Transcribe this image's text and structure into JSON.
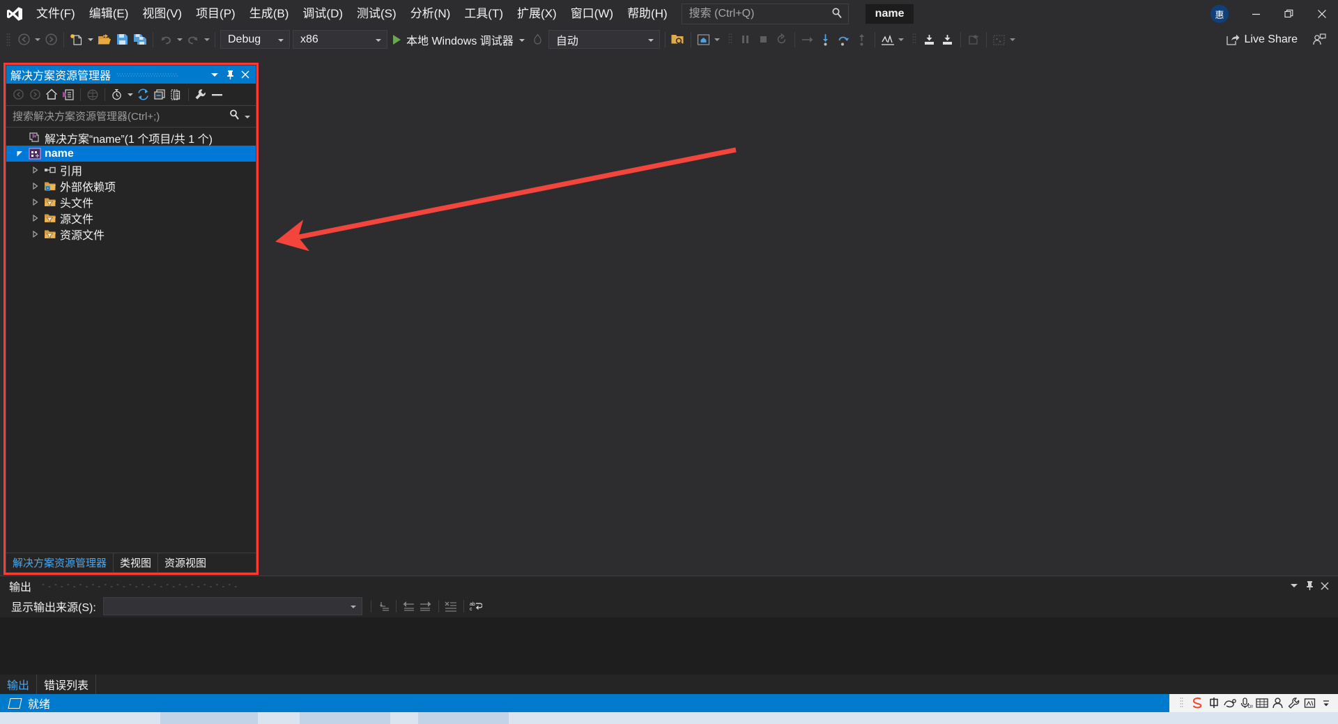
{
  "window": {
    "project_chip": "name",
    "avatar_initial": "惠",
    "live_share": "Live Share",
    "minimize": "—",
    "restore": "❐",
    "close": "✕"
  },
  "menubar": {
    "items": [
      {
        "label": "文件(F)",
        "name": "menu-file"
      },
      {
        "label": "编辑(E)",
        "name": "menu-edit"
      },
      {
        "label": "视图(V)",
        "name": "menu-view"
      },
      {
        "label": "项目(P)",
        "name": "menu-project"
      },
      {
        "label": "生成(B)",
        "name": "menu-build"
      },
      {
        "label": "调试(D)",
        "name": "menu-debug"
      },
      {
        "label": "测试(S)",
        "name": "menu-test"
      },
      {
        "label": "分析(N)",
        "name": "menu-analyze"
      },
      {
        "label": "工具(T)",
        "name": "menu-tools"
      },
      {
        "label": "扩展(X)",
        "name": "menu-extensions"
      },
      {
        "label": "窗口(W)",
        "name": "menu-window"
      },
      {
        "label": "帮助(H)",
        "name": "menu-help"
      }
    ]
  },
  "search": {
    "placeholder": "搜索 (Ctrl+Q)",
    "value": ""
  },
  "toolbar": {
    "configuration": "Debug",
    "platform": "x86",
    "start_label": "本地 Windows 调试器",
    "attach_target": "自动"
  },
  "solution_explorer": {
    "title": "解决方案资源管理器",
    "search_placeholder": "搜索解决方案资源管理器(Ctrl+;)",
    "search_value": "",
    "tree": [
      {
        "label": "解决方案“name”(1 个项目/共 1 个)",
        "indent": 0,
        "icon": "solution-icon",
        "expander": "none",
        "selected": false
      },
      {
        "label": "name",
        "indent": 1,
        "icon": "cpp-project-icon",
        "expander": "expanded",
        "selected": true
      },
      {
        "label": "引用",
        "indent": 2,
        "icon": "references-icon",
        "expander": "collapsed",
        "selected": false
      },
      {
        "label": "外部依赖项",
        "indent": 2,
        "icon": "external-deps-icon",
        "expander": "collapsed",
        "selected": false
      },
      {
        "label": "头文件",
        "indent": 2,
        "icon": "filter-folder-icon",
        "expander": "collapsed",
        "selected": false
      },
      {
        "label": "源文件",
        "indent": 2,
        "icon": "filter-folder-icon",
        "expander": "collapsed",
        "selected": false
      },
      {
        "label": "资源文件",
        "indent": 2,
        "icon": "filter-folder-icon",
        "expander": "collapsed",
        "selected": false
      }
    ],
    "tabs": [
      {
        "label": "解决方案资源管理器",
        "active": true
      },
      {
        "label": "类视图",
        "active": false
      },
      {
        "label": "资源视图",
        "active": false
      }
    ]
  },
  "output": {
    "title": "输出",
    "source_label": "显示输出来源(S):",
    "source_value": "",
    "body_text": ""
  },
  "bottom_tabs": [
    {
      "label": "输出",
      "active": true
    },
    {
      "label": "错误列表",
      "active": false
    }
  ],
  "status": {
    "text": "就绪"
  },
  "colors": {
    "accent": "#007acc",
    "selection": "#0078d7",
    "annotation": "#ff3b30",
    "chrome": "#2d2d30",
    "panel": "#252526",
    "editor": "#1e1e1e"
  }
}
